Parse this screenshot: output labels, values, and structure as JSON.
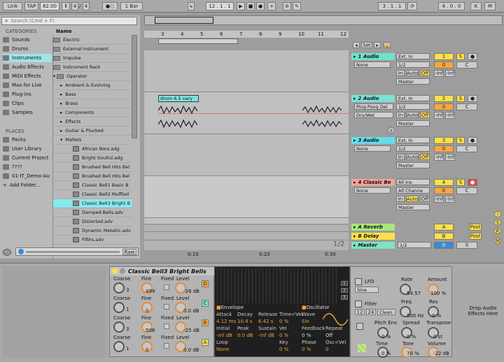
{
  "topbar": {
    "link": "Link",
    "tap": "TAP",
    "tempo": "82.00",
    "sig1": "4",
    "sig2": "4",
    "quant": "1 Bar",
    "position": "12 . 1 . 1",
    "pos2": "3 . 1 . 1",
    "pos3": "4 . 0 . 0",
    "search_placeholder": "Search (Cmd + F)"
  },
  "browser": {
    "categories_header": "CATEGORIES",
    "name_header": "Name",
    "places_header": "PLACES",
    "categories": [
      "Sounds",
      "Drums",
      "Instruments",
      "Audio Effects",
      "MIDI Effects",
      "Max for Live",
      "Plug-ins",
      "Clips",
      "Samples"
    ],
    "places": [
      "Packs",
      "User Library",
      "Current Project",
      "????",
      "01-IT_Demo-Au",
      "Add Folder..."
    ],
    "items": [
      "Electric",
      "External Instrument",
      "Impulse",
      "Instrument Rack",
      "Operator",
      "Ambient & Evolving",
      "Bass",
      "Brass",
      "Components",
      "Effects",
      "Guitar & Plucked",
      "Mallets",
      "African Bars.adg",
      "Bright Soulful.adg",
      "Brushed Bell Hits Bel",
      "Brushed Bell Hits Bel",
      "Classic Bell1 Basic B",
      "Classic Bell2 Muffled",
      "Classic Bell3 Bright B",
      "Damped Bells.adv",
      "Distorted.adv",
      "Dynamic Metallic.adv",
      "Fifths.adv"
    ],
    "raw": "Raw"
  },
  "arrangement": {
    "ruler": [
      "3",
      "4",
      "5",
      "6",
      "7",
      "8",
      "9",
      "10",
      "11",
      "12"
    ],
    "time_labels": [
      "0:10",
      "0:20",
      "0:30"
    ],
    "page": "1/2",
    "clip_name": "drum 6.5 vary",
    "set": "Set"
  },
  "tracks": [
    {
      "name": "1 Audio",
      "color": "#6ee3c8",
      "input": "Ext. In",
      "sub": "1/2",
      "mon": "None",
      "out": "Master",
      "num": "1",
      "vol": "0",
      "pan": "C",
      "inf1": "-inf",
      "inf2": "-inf"
    },
    {
      "name": "2 Audio",
      "color": "#7fe0d8",
      "input": "Ext. In",
      "sub": "1/2",
      "mon": "Ping Pong Del",
      "dry": "Dry/Wet",
      "out": "Master",
      "num": "2",
      "vol": "0",
      "pan": "C",
      "inf1": "-inf",
      "inf2": "-inf"
    },
    {
      "name": "3 Audio",
      "color": "#65dcea",
      "input": "Ext. In",
      "sub": "1/2",
      "mon": "None",
      "out": "Master",
      "num": "3",
      "vol": "0",
      "pan": "C",
      "inf1": "-inf",
      "inf2": "-inf"
    },
    {
      "name": "4 Classic Be",
      "color": "#f2a29a",
      "input": "All Ins",
      "sub": "All Channe",
      "mon": "None",
      "out": "Master",
      "num": "4",
      "vol": "0",
      "pan": "C",
      "inf1": "-inf",
      "inf2": "-inf"
    }
  ],
  "returns": [
    {
      "name": "A Reverb",
      "letter": "A",
      "post": "Post"
    },
    {
      "name": "B Delay",
      "letter": "B",
      "post": "Post"
    },
    {
      "name": "Master",
      "letter": "0",
      "post": "0"
    }
  ],
  "device": {
    "title": "Classic Bell3 Bright Bells",
    "osc_labels": [
      "Coarse",
      "Fine",
      "Fixed",
      "Level"
    ],
    "osc": [
      {
        "coarse": "3",
        "fine": "499",
        "level": "-26 dB",
        "letter": "D"
      },
      {
        "coarse": "1",
        "fine": "0",
        "level": "0.0 dB",
        "letter": "C"
      },
      {
        "coarse": "3",
        "fine": "508",
        "level": "-25 dB",
        "letter": "B"
      },
      {
        "coarse": "1",
        "fine": "0",
        "level": "0.0 dB",
        "letter": "A"
      }
    ],
    "env": {
      "envelope": "Envelope",
      "oscillator": "Oscillator",
      "attack_l": "Attack",
      "decay_l": "Decay",
      "release_l": "Release",
      "timevel_l": "Time<Vel",
      "wave_l": "Wave",
      "attack": "4.12 ms",
      "decay": "10.4 s",
      "release": "6.42 s",
      "timevel": "0 %",
      "wave": "Sin",
      "initial_l": "Initial",
      "peak_l": "Peak",
      "sustain_l": "Sustain",
      "vel_l": "Vel",
      "feedback_l": "Feedback",
      "repeat_l": "Repeat",
      "initial": "-inf dB",
      "peak": "0.0 dB",
      "sustain": "-inf dB",
      "vel": "0 %",
      "feedback": "0 %",
      "repeat": "Off",
      "loop_l": "Loop",
      "key_l": "Key",
      "phase_l": "Phase",
      "oscvel_l": "Osc<Vel",
      "loop": "None",
      "key": "0 %",
      "phase": "0 %",
      "oscvel": "0"
    },
    "lfo": {
      "lfo": "LFO",
      "rate_l": "Rate",
      "amount_l": "Amount",
      "rate": "54.57",
      "amount": "100 %",
      "sine": "Sine",
      "filter": "Filter",
      "freq_l": "Freq",
      "res_l": "Res",
      "freq": "500 Hz",
      "res": "0 %",
      "f12": "12",
      "f24": "24",
      "clean": "Clean",
      "pitchenv": "Pitch Env",
      "spread_l": "Spread",
      "transpose_l": "Transpose",
      "pitchenv_v": "0 %",
      "spread": "0 %",
      "transpose": "0 st",
      "time_l": "Time",
      "tone_l": "Tone",
      "volume_l": "Volume",
      "time": "0 %",
      "tone": "70 %",
      "volume": "-22 dB"
    },
    "drop": "Drop Audio Effects Here"
  },
  "colors": {
    "accent": "#89e8ee",
    "orange": "#f5a83b",
    "yellow": "#ffdf4a"
  }
}
